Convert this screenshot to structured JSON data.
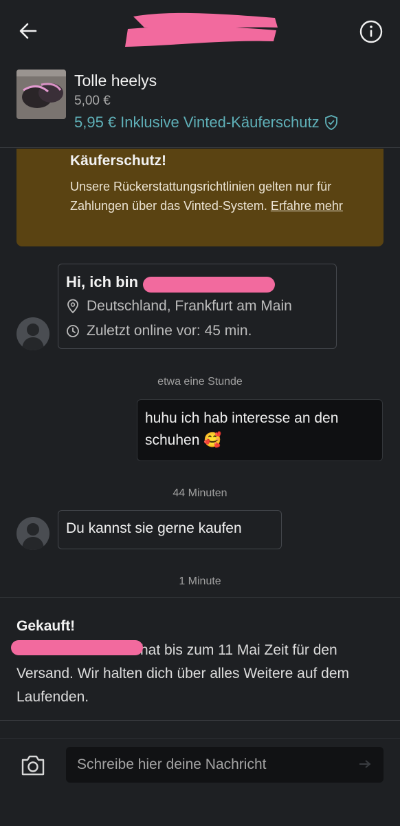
{
  "header": {
    "back_icon": "arrow-left-icon",
    "info_icon": "info-circle-icon"
  },
  "item": {
    "title": "Tolle heelys",
    "price": "5,00 €",
    "total_price": "5,95 €",
    "protection_label": "Inklusive Vinted-Käuferschutz",
    "shield_icon": "shield-check-icon"
  },
  "banner": {
    "title": "Käuferschutz!",
    "text": "Unsere Rückerstattungsrichtlinien gelten nur für Zahlungen über das Vinted-System.",
    "link": "Erfahre mehr"
  },
  "intro": {
    "greeting": "Hi, ich bin",
    "location": "Deutschland, Frankfurt am Main",
    "last_online": "Zuletzt online vor: 45 min."
  },
  "messages": [
    {
      "time": "etwa eine Stunde",
      "sender": "me",
      "text": "huhu ich hab interesse an den schuhen 🥰"
    },
    {
      "time": "44 Minuten",
      "sender": "them",
      "text": "Du kannst sie gerne kaufen"
    }
  ],
  "sold": {
    "time": "1 Minute",
    "title": "Gekauft!",
    "text": "hat bis zum 11 Mai Zeit für den Versand. Wir halten dich über alles Weitere auf dem Laufenden."
  },
  "composer": {
    "placeholder": "Schreibe hier deine Nachricht",
    "camera_icon": "camera-icon",
    "send_icon": "send-icon"
  },
  "colors": {
    "background": "#1e2023",
    "accent": "#5fb0b8",
    "banner": "#5a4312",
    "redaction": "#f26a9e"
  }
}
